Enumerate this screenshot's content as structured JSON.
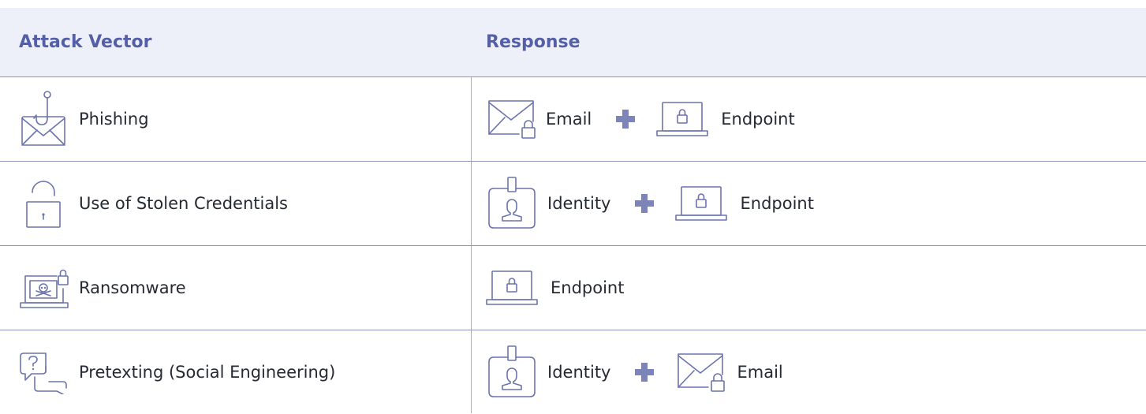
{
  "header": {
    "col_attack": "Attack Vector",
    "col_response": "Response"
  },
  "rows": [
    {
      "vector": {
        "icon": "phishing-icon",
        "label": "Phishing"
      },
      "responses": [
        {
          "icon": "email-icon",
          "label": "Email"
        },
        {
          "icon": "endpoint-icon",
          "label": "Endpoint"
        }
      ]
    },
    {
      "vector": {
        "icon": "open-lock-icon",
        "label": "Use of Stolen Credentials"
      },
      "responses": [
        {
          "icon": "identity-icon",
          "label": "Identity"
        },
        {
          "icon": "endpoint-icon",
          "label": "Endpoint"
        }
      ]
    },
    {
      "vector": {
        "icon": "ransomware-icon",
        "label": "Ransomware"
      },
      "responses": [
        {
          "icon": "endpoint-icon",
          "label": "Endpoint"
        }
      ]
    },
    {
      "vector": {
        "icon": "chat-question-icon",
        "label": "Pretexting (Social Engineering)"
      },
      "responses": [
        {
          "icon": "identity-icon",
          "label": "Identity"
        },
        {
          "icon": "email-icon",
          "label": "Email"
        }
      ]
    }
  ],
  "colors": {
    "header_bg": "#eef0f9",
    "header_text": "#555fa8",
    "icon_stroke": "#6c74ad",
    "plus": "#7d85b8",
    "divider": "#8e94b8"
  }
}
